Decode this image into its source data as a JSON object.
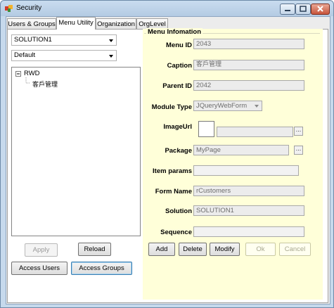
{
  "window": {
    "title": "Security"
  },
  "tabs": [
    {
      "label": "Users & Groups"
    },
    {
      "label": "Menu Utility"
    },
    {
      "label": "Organization"
    },
    {
      "label": "OrgLevel"
    }
  ],
  "left": {
    "solution_combo": "SOLUTION1",
    "default_combo": "Default",
    "tree": {
      "root": "RWD",
      "child": "客戶管理"
    },
    "apply_label": "Apply",
    "reload_label": "Reload",
    "access_users_label": "Access Users",
    "access_groups_label": "Access Groups"
  },
  "menu_info": {
    "legend": "Menu Infomation",
    "menu_id": {
      "label": "Menu ID",
      "value": "2043"
    },
    "caption": {
      "label": "Caption",
      "value": "客戶管理"
    },
    "parent_id": {
      "label": "Parent ID",
      "value": "2042"
    },
    "module_type": {
      "label": "Module Type",
      "value": "JQueryWebForm"
    },
    "image_url": {
      "label": "ImageUrl",
      "value": ""
    },
    "package": {
      "label": "Package",
      "value": "MyPage"
    },
    "item_params": {
      "label": "Item params",
      "value": ""
    },
    "form_name": {
      "label": "Form Name",
      "value": "rCustomers"
    },
    "solution": {
      "label": "Solution",
      "value": "SOLUTION1"
    },
    "sequence": {
      "label": "Sequence",
      "value": ""
    },
    "ellipsis": "...",
    "buttons": {
      "add": "Add",
      "delete": "Delete",
      "modify": "Modify",
      "ok": "Ok",
      "cancel": "Cancel"
    }
  }
}
